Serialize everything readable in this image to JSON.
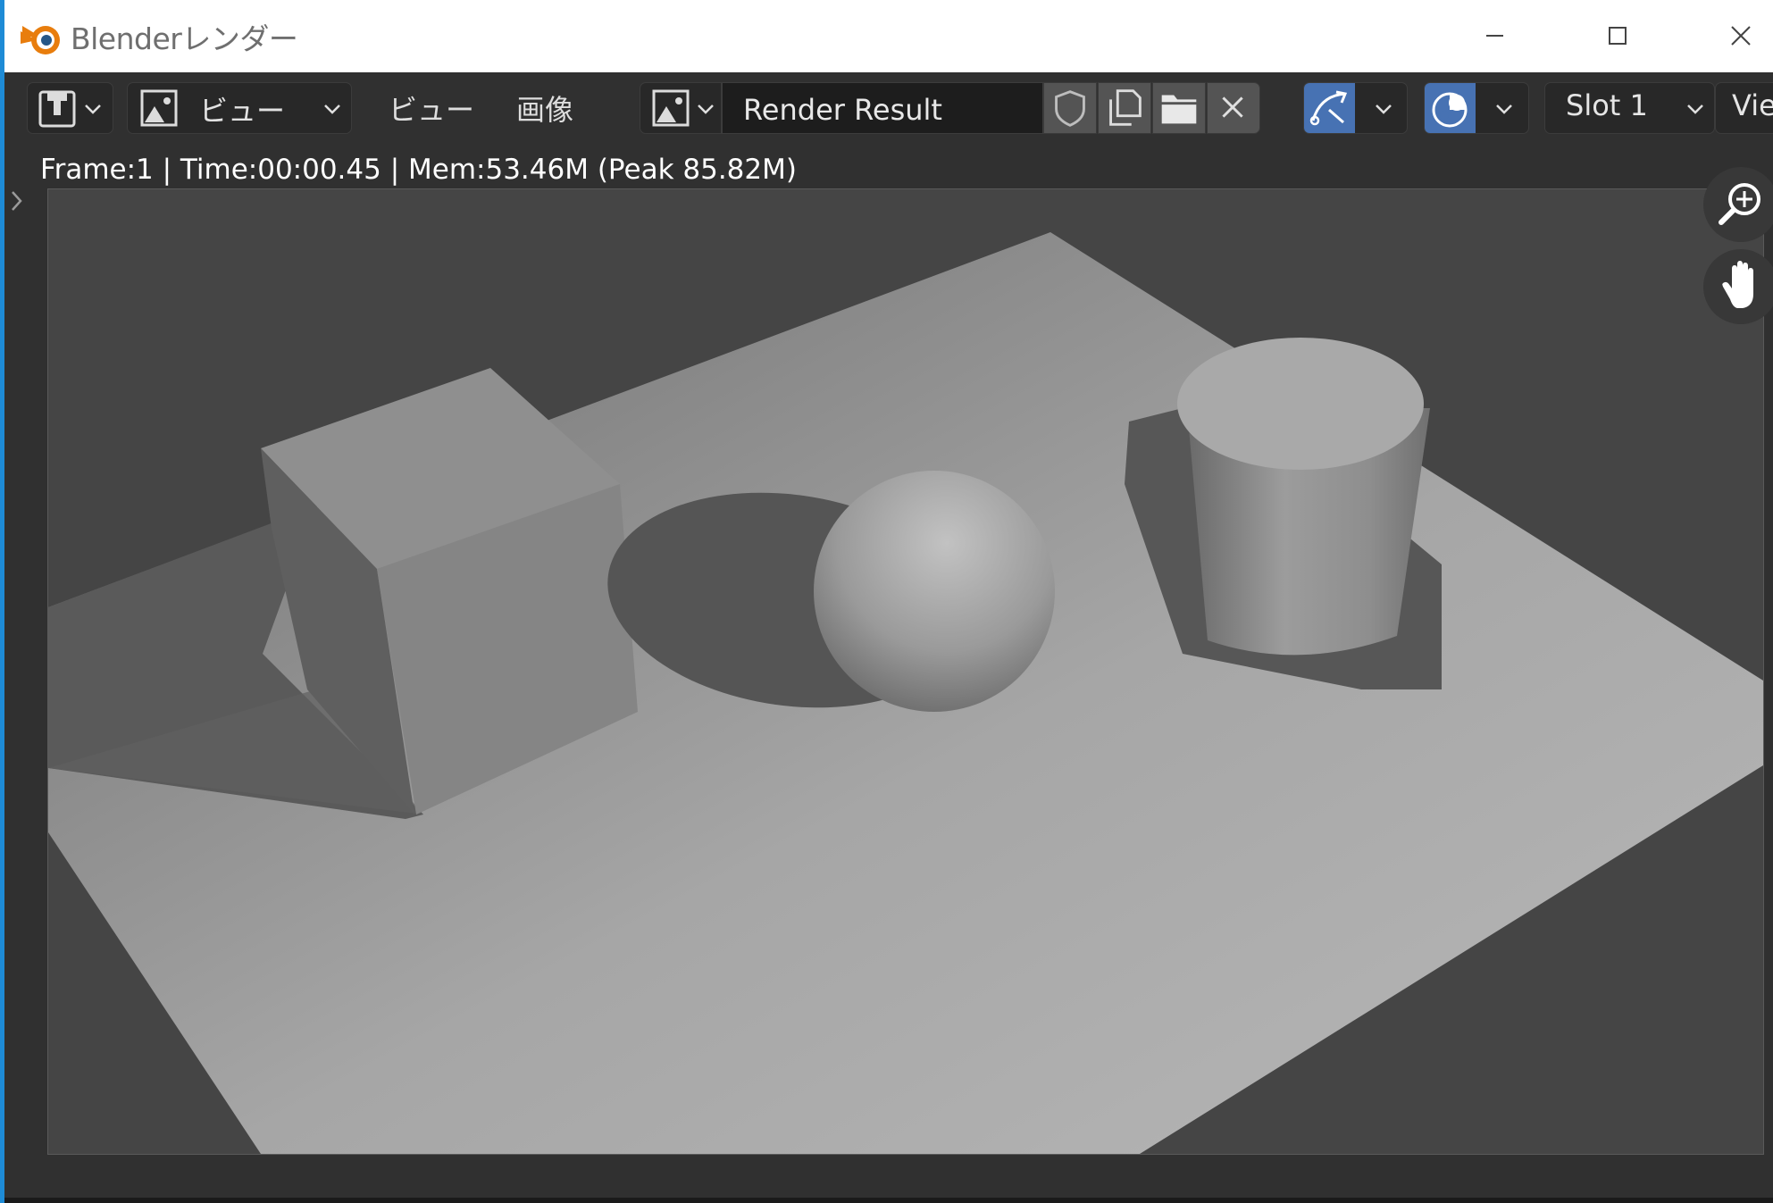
{
  "window": {
    "title": "Blenderレンダー",
    "controls": [
      "minimize-icon",
      "maximize-icon",
      "close-icon"
    ]
  },
  "header": {
    "editor_type_icon": "image-editor-icon",
    "view_mode": {
      "label": "ビュー",
      "icon": "image-icon"
    },
    "menus": {
      "view": "ビュー",
      "image": "画像"
    },
    "image_browse_icon": "image-icon",
    "image_name": "Render Result",
    "image_ops": [
      "shield-icon",
      "duplicate-icon",
      "folder-icon",
      "close-icon"
    ],
    "sample_tool_icon": "sample-tool-icon",
    "scopes_icon": "scopes-icon",
    "slot": "Slot 1",
    "view_layer": "Vie"
  },
  "render_info": {
    "text": "Frame:1 | Time:00:00.45 | Mem:53.46M (Peak 85.82M)"
  },
  "navigation": [
    "zoom-icon",
    "pan-hand-icon"
  ],
  "colors": {
    "accent": "#4772b3",
    "window_border": "#1e8bd6",
    "header_bg": "#303030",
    "field_bg": "#1d1d1d",
    "logo_orange": "#e87d0d"
  }
}
